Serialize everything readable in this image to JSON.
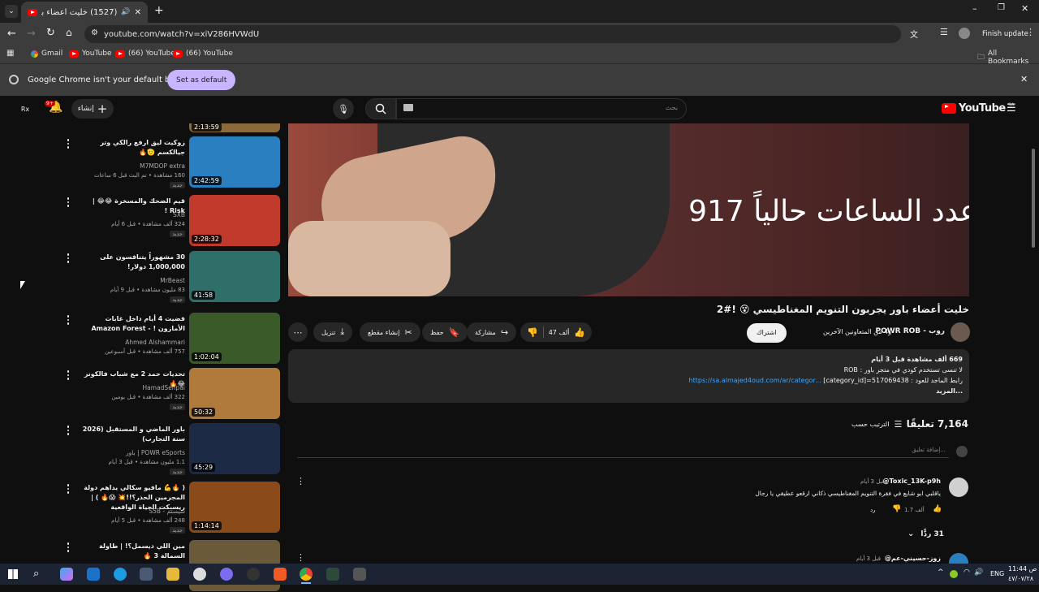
{
  "browser": {
    "tab_title": "(1527) خليت أعضاء باور يجربون...",
    "url": "youtube.com/watch?v=xiV286HVWdU",
    "finish_update": "Finish update",
    "bookmarks": [
      "Gmail",
      "YouTube",
      "(66) YouTube",
      "(66) YouTube"
    ],
    "all_bookmarks": "All Bookmarks",
    "infobar_text": "Google Chrome isn't your default browser",
    "set_default": "Set as default"
  },
  "yt_header": {
    "logo": "YouTube",
    "region": "SA",
    "search_placeholder": "بحث",
    "create": "إنشاء",
    "notif_count": "9+"
  },
  "sidebar": [
    {
      "title": "زوكيت ليق ارفع رالكي وتر جيالكسم 🫡🔥",
      "channel": "M7MDOP extra",
      "meta": "160 مشاهدة • تم البث قبل 6 ساعات",
      "badge": "جديد",
      "duration": "2:42:59",
      "color": "#2a7fc0"
    },
    {
      "title": "قيم الضحك والمسخرة 😂😂 | Risk !",
      "channel": "SXB",
      "meta": "324 ألف مشاهدة • قبل 6 أيام",
      "badge": "جديد",
      "duration": "2:28:32",
      "color": "#c0392b"
    },
    {
      "title": "30 مشهوراً يتنافسون على 1,000,000 دولار!",
      "channel": "MrBeast",
      "meta": "83 مليون مشاهدة • قبل 9 أيام",
      "badge": "جديد",
      "duration": "41:58",
      "color": "#2f6f6a"
    },
    {
      "title": "قضيت 4 أيام داخل غابات الأمازون ! - Amazon Forest",
      "channel": "Ahmed Alshammari",
      "meta": "757 ألف مشاهدة • قبل أسبوعين",
      "badge": "",
      "duration": "1:02:04",
      "color": "#3a5a2a"
    },
    {
      "title": "تحديات حمد 2 مع شباب فالكونز 😂🔥",
      "channel": "HamadSenpai",
      "meta": "322 ألف مشاهدة • قبل يومين",
      "badge": "جديد",
      "duration": "50:32",
      "color": "#b07a3a"
    },
    {
      "title": "باور الماضي و المستقبل (2026 سنة التجارب)",
      "channel": "POWR eSports | باور",
      "meta": "1.1 مليون مشاهدة • قبل 3 أيام",
      "badge": "جديد",
      "duration": "45:29",
      "color": "#1d2a45"
    },
    {
      "title": "( 🔥💪 مافيو سكالي يداهم دولة المجرمين الحذر؟!!💥 😱🔥 ) | ريسبكت الحياة الواقعية",
      "channel": "سيستم - S5B",
      "meta": "248 ألف مشاهدة • قبل 5 أيام",
      "badge": "جديد",
      "duration": "1:14:14",
      "color": "#8a4a1a"
    },
    {
      "title": "مين اللي ديسمل؟! | طاولة السمالة 3 🔥",
      "channel": "BO3OMAR22 - بوعمر",
      "meta": "",
      "badge": "",
      "duration": "",
      "color": "#6a5a3a"
    }
  ],
  "top_partial_duration": "2:13:59",
  "player": {
    "overlay": "عدد الساعات حالياً 917"
  },
  "video": {
    "title": "خليت أعضاء باور يجربون التنويم المغناطيسي 😵 !#2",
    "channel": "روب - POWR ROB",
    "collab": "و4 من المتعاونين الآخرين",
    "subscribe": "اشتراك",
    "likes": "47 ألف",
    "share": "مشاركة",
    "save": "حفظ",
    "clip": "إنشاء مقطع",
    "download": "تنزيل"
  },
  "description": {
    "stats": "669 ألف مشاهدة  قبل 3 أيام",
    "line1": "لا تنسى تستخدم كودي في متجر باور : ROB",
    "line2_prefix": "رابط الماجد للعود :",
    "link": "https://sa.almajed4oud.com/ar/categor...",
    "link_suffix": "[category_id]=517069438",
    "more": "...المزيد"
  },
  "comments": {
    "count": "7,164 تعليقًا",
    "sort": "الترتيب حسب",
    "add_placeholder": "إضافة تعليق...",
    "items": [
      {
        "author": "@Toxic_13K-p9h",
        "time": "قبل 3 أيام",
        "text": "ياقلبي ابو شايع في فقرة التنويم المغناطيسي ذكاني ارقعو عطيقي يا رجال",
        "likes": "1.7 ألف",
        "reply": "رد",
        "replies": "31 ردًّا"
      },
      {
        "author": "@زوز-حسيني-عم",
        "time": "قبل 3 أيام",
        "text": "",
        "likes": "",
        "reply": "",
        "replies": ""
      }
    ]
  },
  "taskbar": {
    "lang": "ENG",
    "time": "11:44 ص",
    "date": "٤٧/٠٧/٢٨"
  }
}
